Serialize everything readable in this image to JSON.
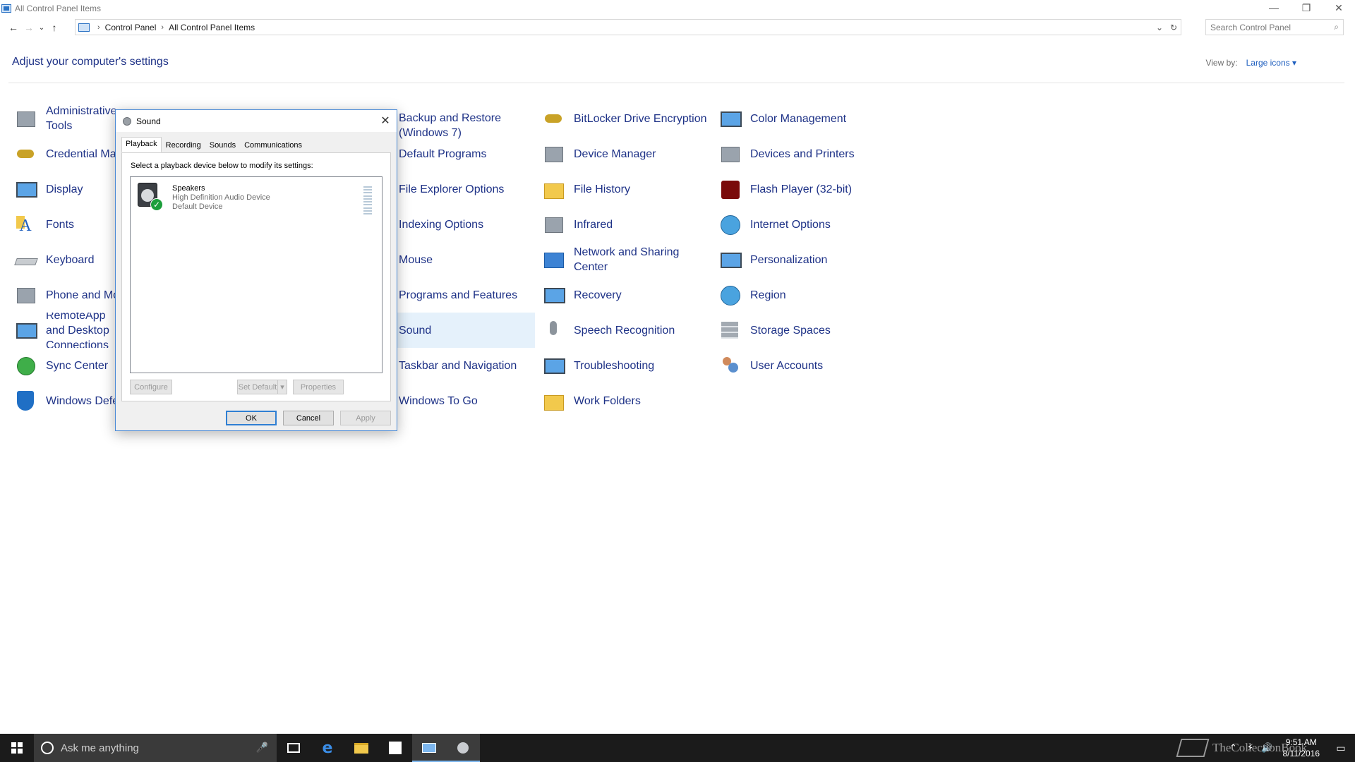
{
  "window": {
    "title": "All Control Panel Items",
    "controls": {
      "minimize": "—",
      "restore": "❐",
      "close": "✕"
    }
  },
  "nav": {
    "back": "←",
    "forward": "→",
    "recent": "⌄",
    "up": "↑",
    "breadcrumb_sep": "›",
    "crumbs": [
      "Control Panel",
      "All Control Panel Items"
    ],
    "dropdown": "⌄",
    "refresh": "↻"
  },
  "search": {
    "placeholder": "Search Control Panel",
    "icon": "⌕"
  },
  "header": {
    "title": "Adjust your computer's settings",
    "view_by_label": "View by:",
    "view_by_value": "Large icons ▾"
  },
  "items": [
    {
      "label": "Administrative Tools",
      "icon": "tools-icon"
    },
    {
      "label": "Credential Manager",
      "icon": "credential-icon"
    },
    {
      "label": "Display",
      "icon": "display-icon"
    },
    {
      "label": "Fonts",
      "icon": "fonts-icon"
    },
    {
      "label": "Keyboard",
      "icon": "keyboard-icon"
    },
    {
      "label": "Phone and Modem",
      "icon": "phone-icon"
    },
    {
      "label": "RemoteApp and Desktop Connections",
      "icon": "remoteapp-icon"
    },
    {
      "label": "Sync Center",
      "icon": "sync-icon"
    },
    {
      "label": "Windows Defender Firewall",
      "icon": "firewall-icon"
    },
    {
      "label": "Backup and Restore (Windows 7)",
      "icon": "backup-icon"
    },
    {
      "label": "Default Programs",
      "icon": "default-programs-icon"
    },
    {
      "label": "File Explorer Options",
      "icon": "folder-options-icon"
    },
    {
      "label": "Indexing Options",
      "icon": "indexing-icon"
    },
    {
      "label": "Mouse",
      "icon": "mouse-icon"
    },
    {
      "label": "Programs and Features",
      "icon": "programs-icon"
    },
    {
      "label": "Sound",
      "icon": "sound-icon"
    },
    {
      "label": "Taskbar and Navigation",
      "icon": "taskbar-icon"
    },
    {
      "label": "Windows To Go",
      "icon": "windows-to-go-icon"
    },
    {
      "label": "BitLocker Drive Encryption",
      "icon": "bitlocker-icon"
    },
    {
      "label": "Device Manager",
      "icon": "device-manager-icon"
    },
    {
      "label": "File History",
      "icon": "file-history-icon"
    },
    {
      "label": "Infrared",
      "icon": "infrared-icon"
    },
    {
      "label": "Network and Sharing Center",
      "icon": "network-icon"
    },
    {
      "label": "Recovery",
      "icon": "recovery-icon"
    },
    {
      "label": "Speech Recognition",
      "icon": "microphone-icon"
    },
    {
      "label": "Troubleshooting",
      "icon": "troubleshooting-icon"
    },
    {
      "label": "Work Folders",
      "icon": "work-folders-icon"
    },
    {
      "label": "Color Management",
      "icon": "color-management-icon"
    },
    {
      "label": "Devices and Printers",
      "icon": "printer-icon"
    },
    {
      "label": "Flash Player (32-bit)",
      "icon": "flash-icon"
    },
    {
      "label": "Internet Options",
      "icon": "internet-options-icon"
    },
    {
      "label": "Personalization",
      "icon": "personalization-icon"
    },
    {
      "label": "Region",
      "icon": "region-icon"
    },
    {
      "label": "Storage Spaces",
      "icon": "storage-icon"
    },
    {
      "label": "User Accounts",
      "icon": "user-accounts-icon"
    }
  ],
  "dialog": {
    "title": "Sound",
    "close": "✕",
    "tabs": [
      "Playback",
      "Recording",
      "Sounds",
      "Communications"
    ],
    "active_tab": "Playback",
    "instruction": "Select a playback device below to modify its settings:",
    "device": {
      "name": "Speakers",
      "description": "High Definition Audio Device",
      "status": "Default Device",
      "check": "✓"
    },
    "buttons": {
      "configure": "Configure",
      "set_default": "Set Default",
      "set_default_arrow": "▾",
      "properties": "Properties",
      "ok": "OK",
      "cancel": "Cancel",
      "apply": "Apply"
    }
  },
  "taskbar": {
    "search_placeholder": "Ask me anything",
    "mic": "🎤",
    "tray": {
      "chevron": "⌃",
      "network": "⚡",
      "volume": "🔊",
      "time": "9:51 AM",
      "date": "8/11/2016",
      "notifications": "▭"
    }
  },
  "watermark": "TheCollectionBook"
}
